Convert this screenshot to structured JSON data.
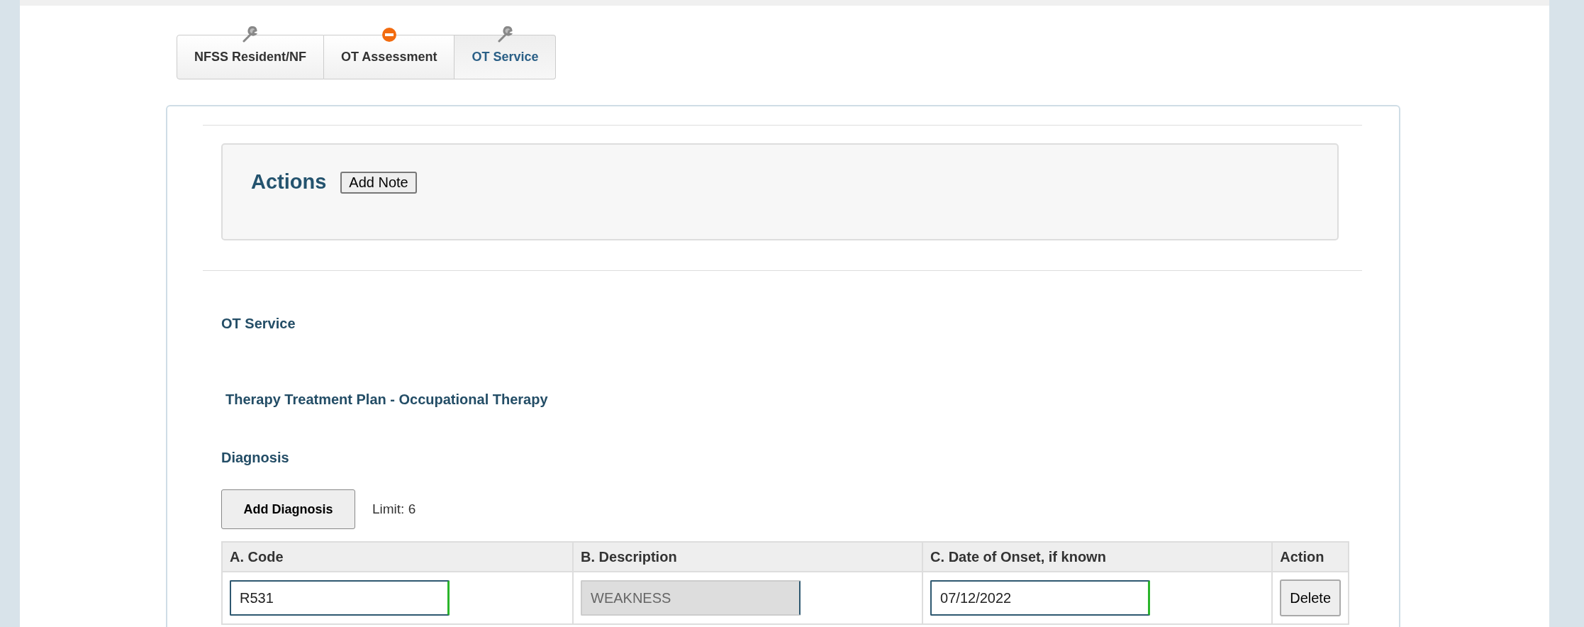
{
  "tabs": [
    {
      "label": "NFSS Resident/NF",
      "kind": "tool",
      "selected": false
    },
    {
      "label": "OT Assessment",
      "kind": "blocked",
      "selected": false
    },
    {
      "label": "OT Service",
      "kind": "tool",
      "selected": true
    }
  ],
  "actions": {
    "title": "Actions",
    "button": "Add Note"
  },
  "section_title": "OT Service",
  "plan_title": "Therapy Treatment Plan - Occupational Therapy",
  "diagnosis": {
    "title": "Diagnosis",
    "add_button": "Add Diagnosis",
    "limit": "Limit: 6",
    "columns": [
      "A. Code",
      "B. Description",
      "C. Date of Onset, if known",
      "Action"
    ],
    "rows": [
      {
        "code": {
          "value": "R531",
          "disabled": false,
          "valid": true
        },
        "description": {
          "value": "WEAKNESS",
          "disabled": true,
          "valid": false
        },
        "date": {
          "value": "07/12/2022",
          "disabled": false,
          "valid": true
        },
        "action": "Delete"
      }
    ]
  }
}
